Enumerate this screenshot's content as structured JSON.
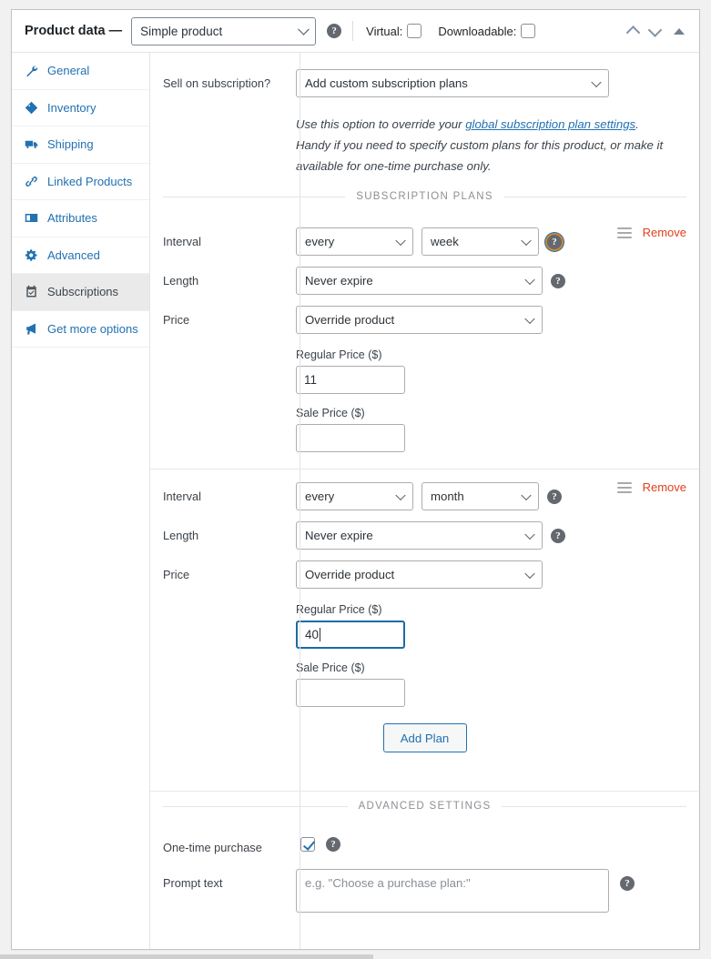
{
  "header": {
    "title": "Product data —",
    "product_type": "Simple product",
    "help_icon": "help-icon",
    "virtual_label": "Virtual:",
    "virtual_checked": false,
    "downloadable_label": "Downloadable:",
    "downloadable_checked": false,
    "move_up_icon": "chevron-up-icon",
    "move_down_icon": "chevron-down-icon",
    "collapse_icon": "triangle-up-icon"
  },
  "sidebar": {
    "items": [
      {
        "label": "General",
        "icon": "wrench-icon",
        "active": false
      },
      {
        "label": "Inventory",
        "icon": "archive-icon",
        "active": false
      },
      {
        "label": "Shipping",
        "icon": "truck-icon",
        "active": false
      },
      {
        "label": "Linked Products",
        "icon": "link-icon",
        "active": false
      },
      {
        "label": "Attributes",
        "icon": "id-card-icon",
        "active": false
      },
      {
        "label": "Advanced",
        "icon": "gear-icon",
        "active": false
      },
      {
        "label": "Subscriptions",
        "icon": "calendar-check-icon",
        "active": true
      },
      {
        "label": "Get more options",
        "icon": "megaphone-icon",
        "active": false
      }
    ]
  },
  "main": {
    "sell_on_subscription": {
      "label": "Sell on subscription?",
      "value": "Add custom subscription plans",
      "description_before": "Use this option to override your ",
      "description_link": "global subscription plan settings",
      "description_after": ". Handy if you need to specify custom plans for this product, or make it available for one-time purchase only."
    },
    "section_plans": "SUBSCRIPTION PLANS",
    "section_advanced": "ADVANCED SETTINGS",
    "labels": {
      "interval": "Interval",
      "length": "Length",
      "price": "Price",
      "regular_price": "Regular Price ($)",
      "sale_price": "Sale Price ($)",
      "remove": "Remove",
      "drag_handle": "drag-handle-icon"
    },
    "plans": [
      {
        "interval_every": "every",
        "interval_period": "week",
        "length": "Never expire",
        "price_mode": "Override product",
        "regular_price": "11",
        "sale_price": "",
        "focused": false,
        "help_ring": true
      },
      {
        "interval_every": "every",
        "interval_period": "month",
        "length": "Never expire",
        "price_mode": "Override product",
        "regular_price": "40",
        "sale_price": "",
        "focused": true,
        "help_ring": false
      }
    ],
    "add_plan_label": "Add Plan",
    "advanced": {
      "one_time_purchase_label": "One-time purchase",
      "one_time_purchase_checked": true,
      "prompt_text_label": "Prompt text",
      "prompt_text_value": "",
      "prompt_text_placeholder": "e.g. \"Choose a purchase plan:\""
    }
  },
  "colors": {
    "accent": "#2271b1",
    "remove": "#e2401c",
    "focus_border": "#1a6ba4",
    "active_nav_bg": "#eaeaea"
  }
}
